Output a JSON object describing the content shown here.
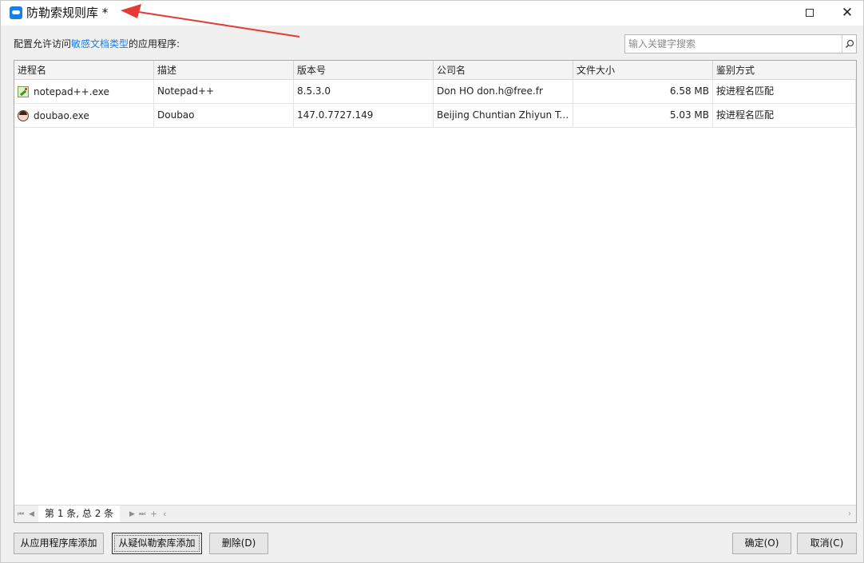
{
  "window": {
    "title": "防勒索规则库 *"
  },
  "intro": {
    "prefix": "配置允许访问",
    "link": "敏感文档类型",
    "suffix": "的应用程序:"
  },
  "search": {
    "placeholder": "输入关键字搜索",
    "value": ""
  },
  "table": {
    "columns": [
      "进程名",
      "描述",
      "版本号",
      "公司名",
      "文件大小",
      "鉴别方式"
    ],
    "rows": [
      {
        "icon": "notepad-icon",
        "process": "notepad++.exe",
        "description": "Notepad++",
        "version": "8.5.3.0",
        "company": "Don HO don.h@free.fr",
        "size": "6.58 MB",
        "auth": "按进程名匹配"
      },
      {
        "icon": "doubao-icon",
        "process": "doubao.exe",
        "description": "Doubao",
        "version": "147.0.7727.149",
        "company": "Beijing Chuntian Zhiyun Tec...",
        "size": "5.03 MB",
        "auth": "按进程名匹配"
      }
    ]
  },
  "pager": {
    "label": "第 1 条, 总 2 条"
  },
  "buttons": {
    "add_from_app_lib": "从应用程序库添加",
    "add_from_ransom_lib": "从疑似勒索库添加",
    "delete": "删除(D)",
    "ok": "确定(O)",
    "cancel": "取消(C)"
  },
  "colors": {
    "accent": "#1a7fe5",
    "annotation_arrow": "#e53935"
  }
}
